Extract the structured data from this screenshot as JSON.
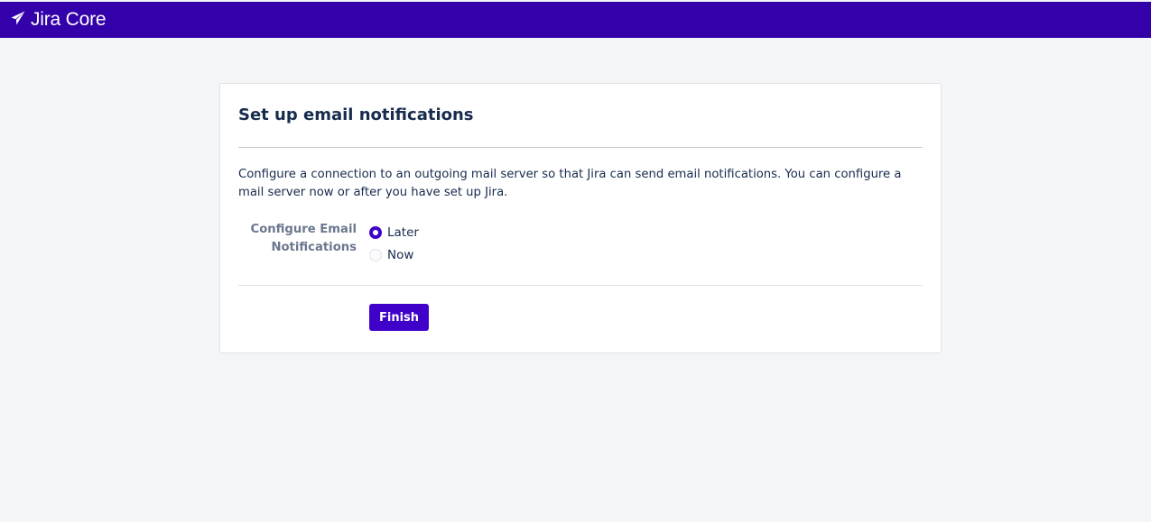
{
  "header": {
    "logo_icon": "jira-core-logo-icon",
    "app_name": "Jira Core",
    "bar_color": "#3300aa"
  },
  "card": {
    "title": "Set up email notifications",
    "description": "Configure a connection to an outgoing mail server so that Jira can send email notifications. You can configure a mail server now or after you have set up Jira.",
    "field_label": "Configure Email Notifications",
    "options": [
      {
        "label": "Later",
        "selected": true
      },
      {
        "label": "Now",
        "selected": false
      }
    ],
    "finish_label": "Finish",
    "accent_color": "#3f00c9"
  }
}
